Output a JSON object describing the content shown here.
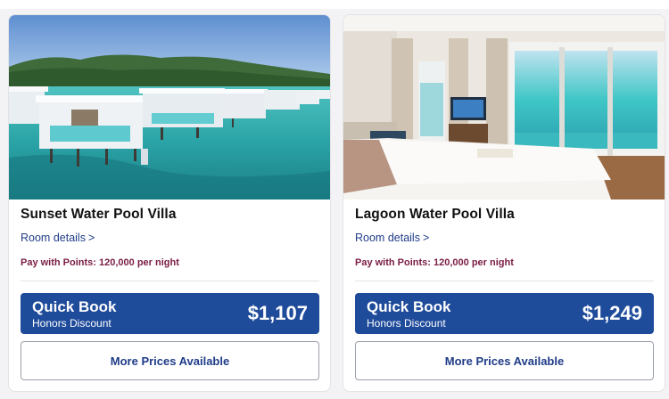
{
  "cards": [
    {
      "title": "Sunset Water Pool Villa",
      "details_label": "Room details",
      "points_text": "Pay with Points: 120,000 per night",
      "quick_book_label": "Quick Book",
      "discount_label": "Honors Discount",
      "price": "$1,107",
      "more_prices_label": "More Prices Available",
      "image_subject": "overwater-villas-photo"
    },
    {
      "title": "Lagoon Water Pool Villa",
      "details_label": "Room details",
      "points_text": "Pay with Points: 120,000 per night",
      "quick_book_label": "Quick Book",
      "discount_label": "Honors Discount",
      "price": "$1,249",
      "more_prices_label": "More Prices Available",
      "image_subject": "villa-bedroom-photo"
    }
  ],
  "colors": {
    "primary_blue": "#1f4b9b",
    "link_blue": "#1f3c88",
    "points_maroon": "#7a1d45",
    "border_gray": "#9aa0aa"
  }
}
